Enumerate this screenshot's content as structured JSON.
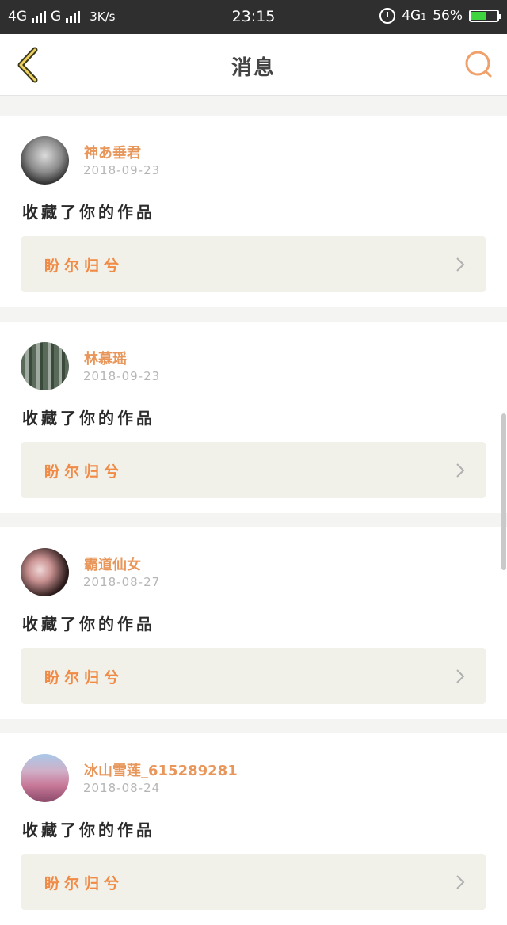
{
  "status_bar": {
    "network_left": "4G",
    "network_mid": "G",
    "speed": "3K/s",
    "time": "23:15",
    "network_right": "4G",
    "network_right_sub": "1",
    "battery": "56%"
  },
  "header": {
    "title": "消息"
  },
  "messages": [
    {
      "name": "神あ垂君",
      "date": "2018-09-23",
      "action": "收藏了你的作品",
      "work": "盼尔归兮"
    },
    {
      "name": "林慕瑶",
      "date": "2018-09-23",
      "action": "收藏了你的作品",
      "work": "盼尔归兮"
    },
    {
      "name": "霸道仙女",
      "date": "2018-08-27",
      "action": "收藏了你的作品",
      "work": "盼尔归兮"
    },
    {
      "name": "冰山雪莲_615289281",
      "date": "2018-08-24",
      "action": "收藏了你的作品",
      "work": "盼尔归兮"
    }
  ],
  "colors": {
    "accent": "#e8965a",
    "link_bg": "#f1f1e9",
    "back_icon": "#d4a017"
  },
  "icons": {
    "back": "back-chevron-icon",
    "search": "search-icon",
    "chevron": "chevron-right-icon"
  }
}
